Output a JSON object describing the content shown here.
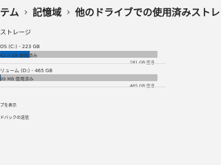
{
  "breadcrumb": {
    "items": [
      "テム",
      "記憶域",
      "他のドライブでの使用済みストレ"
    ],
    "separator": "›"
  },
  "section_title": "ストレージ",
  "drives": [
    {
      "name": "OS (C:) - 223 GB",
      "used_label": "42.0 GB 使用済み",
      "free_label": "181 GB 空き",
      "used_fraction": 0.19
    },
    {
      "name": "リューム (D:) - 465 GB",
      "used_label": "99 MB 使用済み",
      "free_label": "465 GB 空き",
      "used_fraction": 0.0
    }
  ],
  "links": [
    "プを表示",
    "ドバックの送信"
  ],
  "colors": {
    "accent": "#0a63b8",
    "track": "#bdbdbd",
    "background": "#f3f3f3"
  }
}
